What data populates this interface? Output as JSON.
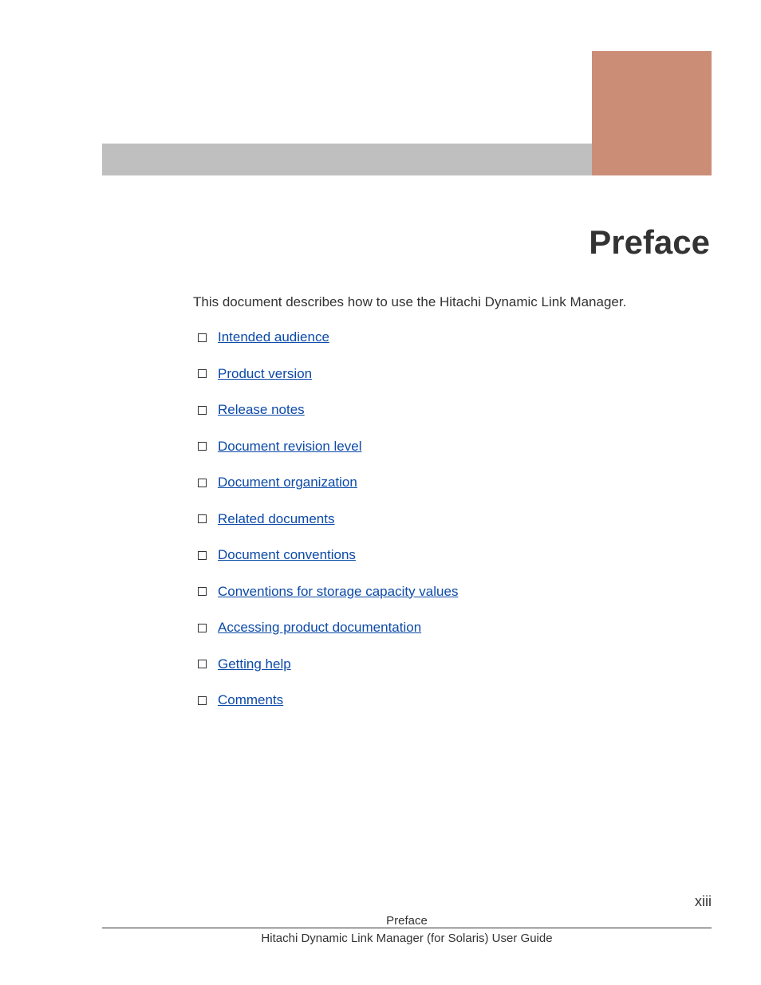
{
  "title": "Preface",
  "intro": "This document describes how to use the Hitachi Dynamic Link Manager.",
  "toc": [
    {
      "label": "Intended audience"
    },
    {
      "label": "Product version"
    },
    {
      "label": "Release notes"
    },
    {
      "label": "Document revision level"
    },
    {
      "label": "Document organization"
    },
    {
      "label": "Related documents"
    },
    {
      "label": "Document conventions"
    },
    {
      "label": "Conventions for storage capacity values"
    },
    {
      "label": "Accessing product documentation"
    },
    {
      "label": "Getting help"
    },
    {
      "label": "Comments"
    }
  ],
  "footer": {
    "section": "Preface",
    "doc_title": "Hitachi Dynamic Link Manager (for Solaris) User Guide",
    "page": "xiii"
  }
}
